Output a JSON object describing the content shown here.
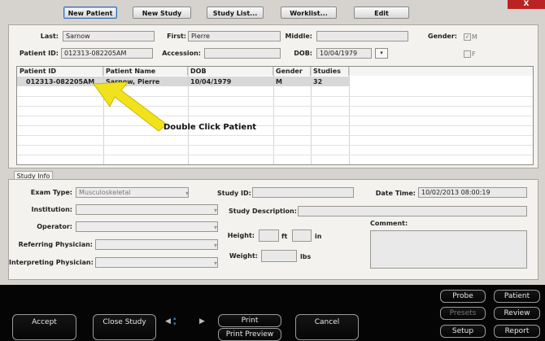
{
  "toolbar": {
    "new_patient": "New Patient",
    "new_study": "New Study",
    "study_list": "Study List...",
    "worklist": "Worklist...",
    "edit": "Edit"
  },
  "window": {
    "close_label": "X"
  },
  "patient": {
    "last_label": "Last:",
    "last_value": "Sarnow",
    "first_label": "First:",
    "first_value": "Pierre",
    "middle_label": "Middle:",
    "middle_value": "",
    "gender_label": "Gender:",
    "gender_m": "M",
    "gender_f": "F",
    "id_label": "Patient ID:",
    "id_value": "012313-082205AM",
    "accession_label": "Accession:",
    "accession_value": "",
    "dob_label": "DOB:",
    "dob_value": "10/04/1979"
  },
  "grid": {
    "columns": [
      "Patient ID",
      "Patient Name",
      "DOB",
      "Gender",
      "Studies"
    ],
    "rows": [
      [
        "012313-082205AM",
        "Sarnow, Pierre",
        "10/04/1979",
        "M",
        "32"
      ]
    ]
  },
  "annotation": {
    "text": "Double Click Patient",
    "arrow_color": "#f2e21c"
  },
  "study": {
    "tab": "Study Info",
    "exam_type_label": "Exam Type:",
    "exam_type_value": "Musculoskeletal",
    "institution_label": "Institution:",
    "operator_label": "Operator:",
    "referring_label": "Referring Physician:",
    "interpreting_label": "Interpreting Physician:",
    "study_id_label": "Study ID:",
    "study_desc_label": "Study Description:",
    "height_label": "Height:",
    "ft": "ft",
    "in": "in",
    "weight_label": "Weight:",
    "lbs": "lbs",
    "datetime_label": "Date Time:",
    "datetime_value": "10/02/2013 08:00:19",
    "comment_label": "Comment:"
  },
  "bottom": {
    "accept": "Accept",
    "close_study": "Close Study",
    "print": "Print",
    "print_preview": "Print Preview",
    "cancel": "Cancel",
    "probe": "Probe",
    "patient": "Patient",
    "presets": "Presets",
    "review": "Review",
    "setup": "Setup",
    "report": "Report"
  }
}
